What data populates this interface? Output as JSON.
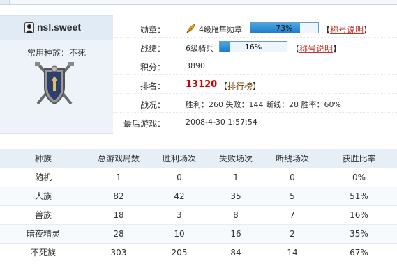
{
  "colors": {
    "accent_blue": "#1f7dc9",
    "header_bg": "#e6eef6",
    "panel_bg": "#edf3f9",
    "rank_red": "#cc0000",
    "link_red": "#c0392b"
  },
  "profile": {
    "avatar_icon": "user-avatar-icon",
    "username": "nsl.sweet",
    "race_label": "常用种族：不死",
    "emblem_icon": "shield-crest-icon"
  },
  "info": {
    "medal": {
      "label": "勋章：",
      "icon": "feather-medal-icon",
      "value": "4级雁隼勋章",
      "progress": 0.73,
      "progress_text": "73%",
      "bracket_open": "【",
      "link": "称号说明",
      "bracket_close": "】"
    },
    "record": {
      "label": "战绩：",
      "value": "6级骑兵",
      "progress": 0.16,
      "progress_text": "16%",
      "bracket_open": "【",
      "link": "称号说明",
      "bracket_close": "】"
    },
    "points": {
      "label": "积分：",
      "value": "3890"
    },
    "rank": {
      "label": "排名：",
      "value": "13120",
      "bracket_open": "【",
      "link": "排行榜",
      "bracket_close": "】"
    },
    "battle": {
      "label": "战况：",
      "value": "胜利：260 失败：144 断线：28 胜率：60%"
    },
    "last_game": {
      "label": "最后游戏：",
      "value": "2008-4-30 1:57:54"
    }
  },
  "table": {
    "headers": [
      "种族",
      "总游戏局数",
      "胜利场次",
      "失败场次",
      "断线场次",
      "获胜比率"
    ],
    "rows": [
      [
        "随机",
        "1",
        "0",
        "1",
        "0",
        "0%"
      ],
      [
        "人族",
        "82",
        "42",
        "35",
        "5",
        "51%"
      ],
      [
        "兽族",
        "18",
        "3",
        "8",
        "7",
        "16%"
      ],
      [
        "暗夜精灵",
        "28",
        "10",
        "16",
        "2",
        "35%"
      ],
      [
        "不死族",
        "303",
        "205",
        "84",
        "14",
        "67%"
      ]
    ]
  }
}
